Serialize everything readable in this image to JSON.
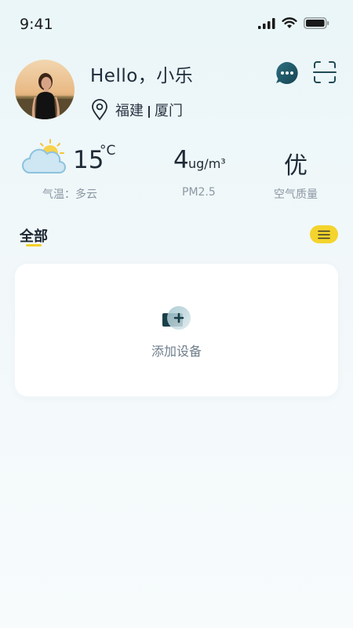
{
  "status_bar": {
    "time": "9:41"
  },
  "profile": {
    "greeting": "Hello，小乐",
    "location_province": "福建",
    "location_city": "厦门"
  },
  "weather": {
    "temperature": "15",
    "temperature_unit": "°C",
    "temperature_label": "气温：多云",
    "pm25_value": "4",
    "pm25_unit": "ug/m³",
    "pm25_label": "PM2.5",
    "air_quality_value": "优",
    "air_quality_label": "空气质量"
  },
  "tabs": {
    "all_label": "全部"
  },
  "device_card": {
    "add_label": "添加设备"
  },
  "colors": {
    "accent_yellow": "#f4d42c",
    "chat_teal": "#1f5a6a",
    "text_dark": "#1d2b3a",
    "label_gray": "#8b97a3"
  },
  "icons": [
    "signal-icon",
    "wifi-icon",
    "battery-icon",
    "location-pin-icon",
    "chat-icon",
    "scan-icon",
    "weather-partly-cloudy-icon",
    "menu-icon",
    "add-device-icon"
  ]
}
